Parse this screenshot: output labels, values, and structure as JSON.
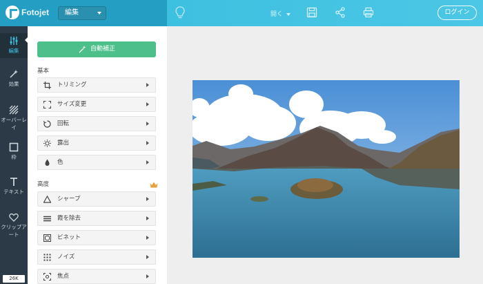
{
  "topbar": {
    "logo_text": "Fotojet",
    "mode_select": "編集",
    "open_label": "開く",
    "login_label": "ログイン"
  },
  "rail": {
    "items": [
      {
        "label": "編集",
        "icon": "sliders-icon"
      },
      {
        "label": "効果",
        "icon": "magic-icon"
      },
      {
        "label": "オーバーレイ",
        "icon": "overlay-icon"
      },
      {
        "label": "枠",
        "icon": "frame-icon"
      },
      {
        "label": "テキスト",
        "icon": "text-icon"
      },
      {
        "label": "クリップアート",
        "icon": "heart-icon"
      }
    ],
    "badge": "26K"
  },
  "panel": {
    "auto_label": "自動補正",
    "basic_label": "基本",
    "advanced_label": "高度",
    "basic_tools": [
      {
        "label": "トリミング",
        "icon": "crop-icon"
      },
      {
        "label": "サイズ変更",
        "icon": "resize-icon"
      },
      {
        "label": "回転",
        "icon": "rotate-icon"
      },
      {
        "label": "露出",
        "icon": "exposure-icon"
      },
      {
        "label": "色",
        "icon": "color-drop-icon"
      }
    ],
    "advanced_tools": [
      {
        "label": "シャープ",
        "icon": "sharpen-icon"
      },
      {
        "label": "霞を除去",
        "icon": "dehaze-icon"
      },
      {
        "label": "ビネット",
        "icon": "vignette-icon"
      },
      {
        "label": "ノイズ",
        "icon": "noise-icon"
      },
      {
        "label": "焦点",
        "icon": "focus-icon"
      }
    ]
  },
  "colors": {
    "accent": "#3ec0e0",
    "auto_button": "#4cbf8a",
    "rail": "#2c3a47"
  }
}
